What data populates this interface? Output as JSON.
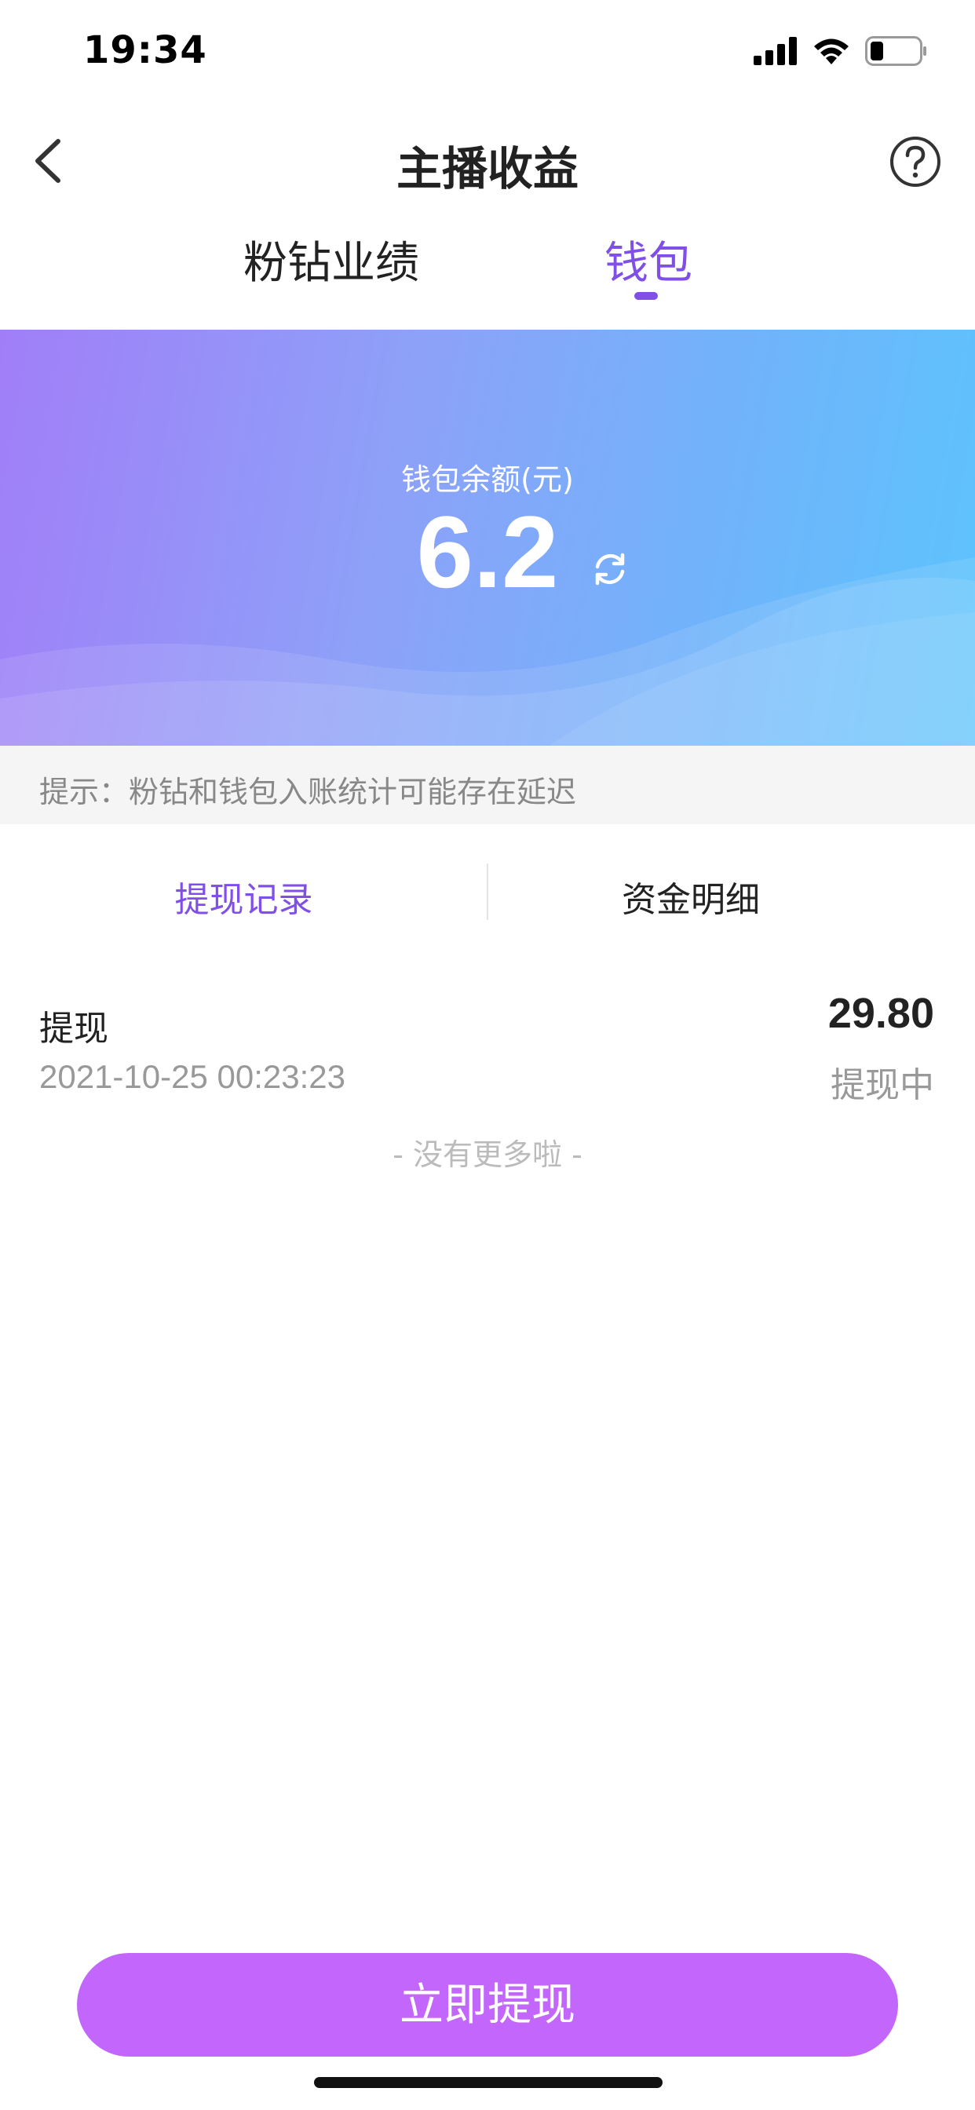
{
  "status_bar": {
    "time": "19:34"
  },
  "nav": {
    "title": "主播收益"
  },
  "tabs": [
    {
      "label": "粉钻业绩",
      "active": false
    },
    {
      "label": "钱包",
      "active": true
    }
  ],
  "wallet": {
    "balance_label": "钱包余额(元)",
    "balance": "6.2"
  },
  "tip": "提示：粉钻和钱包入账统计可能存在延迟",
  "sub_tabs": [
    {
      "label": "提现记录",
      "active": true
    },
    {
      "label": "资金明细",
      "active": false
    }
  ],
  "records": [
    {
      "type": "提现",
      "time": "2021-10-25 00:23:23",
      "amount": "29.80",
      "status": "提现中"
    }
  ],
  "list_end": "- 没有更多啦 -",
  "withdraw_button": "立即提现",
  "colors": {
    "accent": "#7f4fe8",
    "button": "#c266fc",
    "banner_start": "#a17ef8",
    "banner_end": "#5cc4fc"
  }
}
